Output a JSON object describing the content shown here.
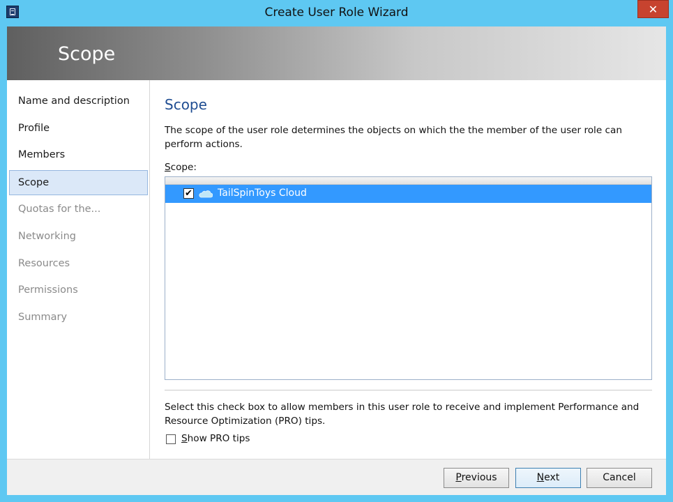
{
  "window": {
    "title": "Create User Role Wizard",
    "close_glyph": "✕"
  },
  "banner": {
    "title": "Scope"
  },
  "sidebar": {
    "items": [
      {
        "label": "Name and description",
        "state": "completed"
      },
      {
        "label": "Profile",
        "state": "completed"
      },
      {
        "label": "Members",
        "state": "completed"
      },
      {
        "label": "Scope",
        "state": "selected"
      },
      {
        "label": "Quotas for the...",
        "state": "disabled"
      },
      {
        "label": "Networking",
        "state": "disabled"
      },
      {
        "label": "Resources",
        "state": "disabled"
      },
      {
        "label": "Permissions",
        "state": "disabled"
      },
      {
        "label": "Summary",
        "state": "disabled"
      }
    ]
  },
  "main": {
    "heading": "Scope",
    "description": "The scope of the user role determines the objects on which the the member of the user role can perform actions.",
    "scope_label_access": "S",
    "scope_label_rest": "cope:",
    "scope_items": [
      {
        "label": "TailSpinToys Cloud",
        "checked": true,
        "icon": "cloud-icon",
        "check_glyph": "✔"
      }
    ],
    "pro_text": "Select this check box to allow members in this user role to receive and implement Performance and Resource Optimization (PRO) tips.",
    "pro_checkbox": {
      "label_access": "S",
      "label_rest": "how PRO tips",
      "checked": false
    }
  },
  "footer": {
    "previous": {
      "access": "P",
      "rest": "revious"
    },
    "next": {
      "access": "N",
      "rest": "ext"
    },
    "cancel": "Cancel"
  },
  "colors": {
    "title_bar": "#5ec8f2",
    "selected_row": "#3399ff",
    "close_button": "#c7432f",
    "heading": "#1f4d92",
    "nav_selected": "#dbe8f8"
  }
}
